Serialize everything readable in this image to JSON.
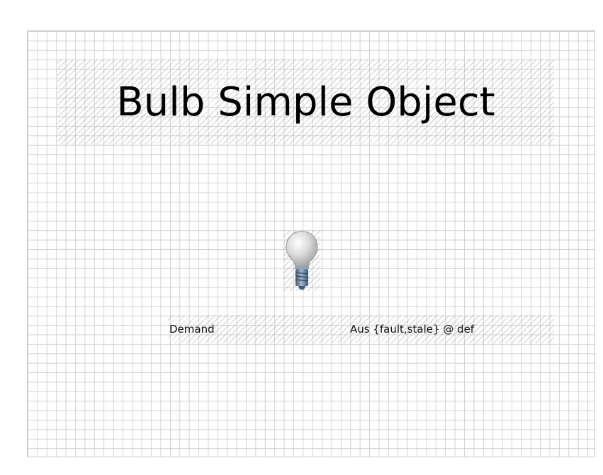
{
  "title": "Bulb Simple Object",
  "bulb": {
    "icon": "lightbulb-icon",
    "colors": {
      "glass": "#c9c9c9",
      "base": "#5e7a96"
    }
  },
  "point": {
    "label": "Demand",
    "value": "Aus {fault,stale} @ def"
  }
}
